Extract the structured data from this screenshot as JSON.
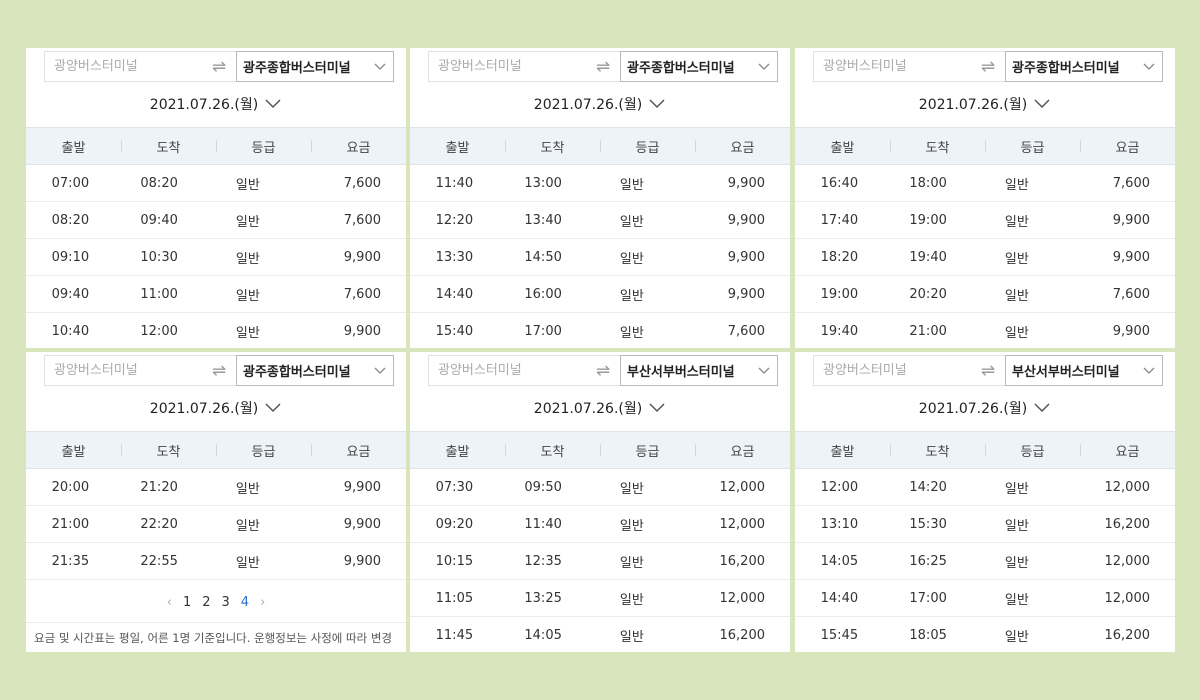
{
  "panels": [
    {
      "from_placeholder": "광양버스터미널",
      "destination": "광주종합버스터미널",
      "date": "2021.07.26.(월)",
      "headers": [
        "출발",
        "도착",
        "등급",
        "요금"
      ],
      "rows": [
        [
          "07:00",
          "08:20",
          "일반",
          "7,600"
        ],
        [
          "08:20",
          "09:40",
          "일반",
          "7,600"
        ],
        [
          "09:10",
          "10:30",
          "일반",
          "9,900"
        ],
        [
          "09:40",
          "11:00",
          "일반",
          "7,600"
        ],
        [
          "10:40",
          "12:00",
          "일반",
          "9,900"
        ]
      ]
    },
    {
      "from_placeholder": "광양버스터미널",
      "destination": "광주종합버스터미널",
      "date": "2021.07.26.(월)",
      "headers": [
        "출발",
        "도착",
        "등급",
        "요금"
      ],
      "rows": [
        [
          "11:40",
          "13:00",
          "일반",
          "9,900"
        ],
        [
          "12:20",
          "13:40",
          "일반",
          "9,900"
        ],
        [
          "13:30",
          "14:50",
          "일반",
          "9,900"
        ],
        [
          "14:40",
          "16:00",
          "일반",
          "9,900"
        ],
        [
          "15:40",
          "17:00",
          "일반",
          "7,600"
        ]
      ]
    },
    {
      "from_placeholder": "광양버스터미널",
      "destination": "광주종합버스터미널",
      "date": "2021.07.26.(월)",
      "headers": [
        "출발",
        "도착",
        "등급",
        "요금"
      ],
      "rows": [
        [
          "16:40",
          "18:00",
          "일반",
          "7,600"
        ],
        [
          "17:40",
          "19:00",
          "일반",
          "9,900"
        ],
        [
          "18:20",
          "19:40",
          "일반",
          "9,900"
        ],
        [
          "19:00",
          "20:20",
          "일반",
          "7,600"
        ],
        [
          "19:40",
          "21:00",
          "일반",
          "9,900"
        ]
      ]
    },
    {
      "from_placeholder": "광양버스터미널",
      "destination": "광주종합버스터미널",
      "date": "2021.07.26.(월)",
      "headers": [
        "출발",
        "도착",
        "등급",
        "요금"
      ],
      "rows": [
        [
          "20:00",
          "21:20",
          "일반",
          "9,900"
        ],
        [
          "21:00",
          "22:20",
          "일반",
          "9,900"
        ],
        [
          "21:35",
          "22:55",
          "일반",
          "9,900"
        ]
      ],
      "pagination": {
        "prev": "‹",
        "next": "›",
        "pages": [
          "1",
          "2",
          "3",
          "4"
        ],
        "active": "4"
      },
      "notice": "요금 및 시간표는 평일, 어른 1명 기준입니다. 운행정보는 사정에 따라 변경"
    },
    {
      "from_placeholder": "광양버스터미널",
      "destination": "부산서부버스터미널",
      "date": "2021.07.26.(월)",
      "headers": [
        "출발",
        "도착",
        "등급",
        "요금"
      ],
      "rows": [
        [
          "07:30",
          "09:50",
          "일반",
          "12,000"
        ],
        [
          "09:20",
          "11:40",
          "일반",
          "12,000"
        ],
        [
          "10:15",
          "12:35",
          "일반",
          "16,200"
        ],
        [
          "11:05",
          "13:25",
          "일반",
          "12,000"
        ],
        [
          "11:45",
          "14:05",
          "일반",
          "16,200"
        ]
      ]
    },
    {
      "from_placeholder": "광양버스터미널",
      "destination": "부산서부버스터미널",
      "date": "2021.07.26.(월)",
      "headers": [
        "출발",
        "도착",
        "등급",
        "요금"
      ],
      "rows": [
        [
          "12:00",
          "14:20",
          "일반",
          "12,000"
        ],
        [
          "13:10",
          "15:30",
          "일반",
          "16,200"
        ],
        [
          "14:05",
          "16:25",
          "일반",
          "12,000"
        ],
        [
          "14:40",
          "17:00",
          "일반",
          "12,000"
        ],
        [
          "15:45",
          "18:05",
          "일반",
          "16,200"
        ]
      ]
    }
  ],
  "icons": {
    "swap": "swap-arrows-icon",
    "dropdown": "chevron-down-icon"
  },
  "colors": {
    "background": "#d8e5bd",
    "header_bg": "#eef3f8",
    "active_page": "#2f6fd6"
  }
}
